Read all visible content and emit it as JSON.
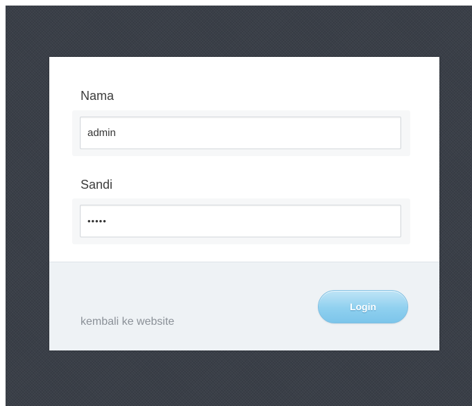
{
  "form": {
    "username_label": "Nama",
    "username_value": "admin",
    "password_label": "Sandi",
    "password_value": "•••••",
    "back_link_text": "kembali ke website",
    "login_label": "Login"
  },
  "colors": {
    "background": "#3a3f48",
    "panel": "#ffffff",
    "footer": "#eef2f5",
    "button": "#8fd0ef",
    "link": "#8a9097"
  }
}
